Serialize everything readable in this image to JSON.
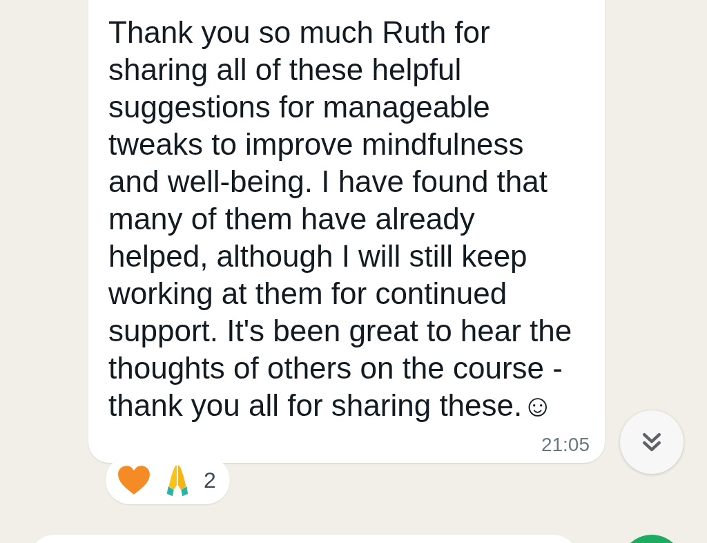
{
  "message": {
    "text": "Thank you so much Ruth for sharing all of these helpful suggestions for manageable tweaks to improve mindfulness and well-being. I have found that many of them have already helped, although I will still keep working at them for continued support. It's been great to hear the thoughts of others on the course - thank you all for sharing these.☺",
    "time": "21:05"
  },
  "reactions": {
    "count": "2"
  }
}
